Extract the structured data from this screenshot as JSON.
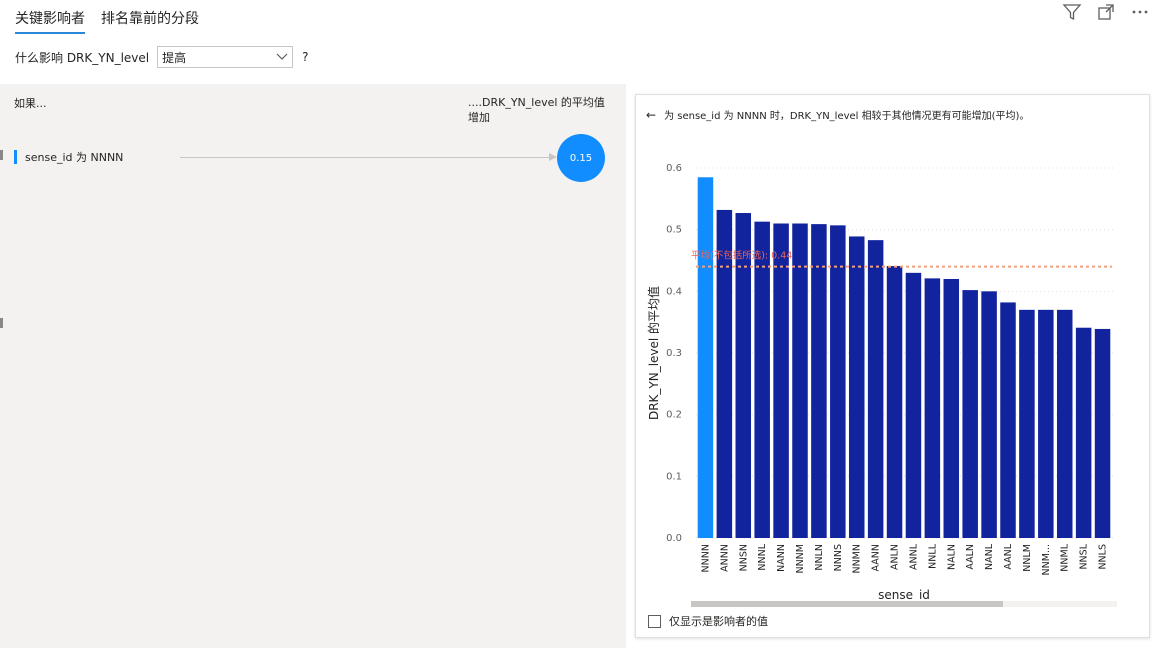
{
  "tabs": [
    {
      "label": "关键影响者",
      "active": true
    },
    {
      "label": "排名靠前的分段",
      "active": false
    }
  ],
  "question": {
    "label": "什么影响 DRK_YN_level",
    "selected": "提高",
    "help": "?"
  },
  "left_panel": {
    "header_left": "如果...",
    "header_right": "....DRK_YN_level 的平均值增加",
    "factor_label": "sense_id 为 NNNN",
    "factor_value": "0.15"
  },
  "detail": {
    "title": "为 sense_id 为 NNNN 时，DRK_YN_level 相较于其他情况更有可能增加(平均)。",
    "checkbox_label": "仅显示是影响者的值"
  },
  "colors": {
    "highlight": "#118dff",
    "bar": "#12239e",
    "avg_line": "#f2a17f",
    "accent": "#2b88d8"
  },
  "chart_data": {
    "type": "bar",
    "categories": [
      "NNNN",
      "ANNN",
      "NNSN",
      "NNNL",
      "NANN",
      "NNNM",
      "NNLN",
      "NNNS",
      "NNMN",
      "AANN",
      "ANLN",
      "ANNL",
      "NNLL",
      "NALN",
      "AALN",
      "NANL",
      "AANL",
      "NNLM",
      "NNM...",
      "NNML",
      "NNSL",
      "NNLS"
    ],
    "values": [
      0.585,
      0.532,
      0.527,
      0.513,
      0.51,
      0.51,
      0.509,
      0.507,
      0.489,
      0.483,
      0.441,
      0.43,
      0.421,
      0.42,
      0.402,
      0.4,
      0.382,
      0.37,
      0.37,
      0.37,
      0.341,
      0.339
    ],
    "highlight_index": 0,
    "average": 0.44,
    "average_label": "平均(不包括所选): 0.44",
    "ylim": [
      0,
      0.6
    ],
    "yticks": [
      "0.0",
      "0.1",
      "0.2",
      "0.3",
      "0.4",
      "0.5",
      "0.6"
    ],
    "xlabel": "sense_id",
    "ylabel": "DRK_YN_level 的平均值",
    "grid": true
  }
}
